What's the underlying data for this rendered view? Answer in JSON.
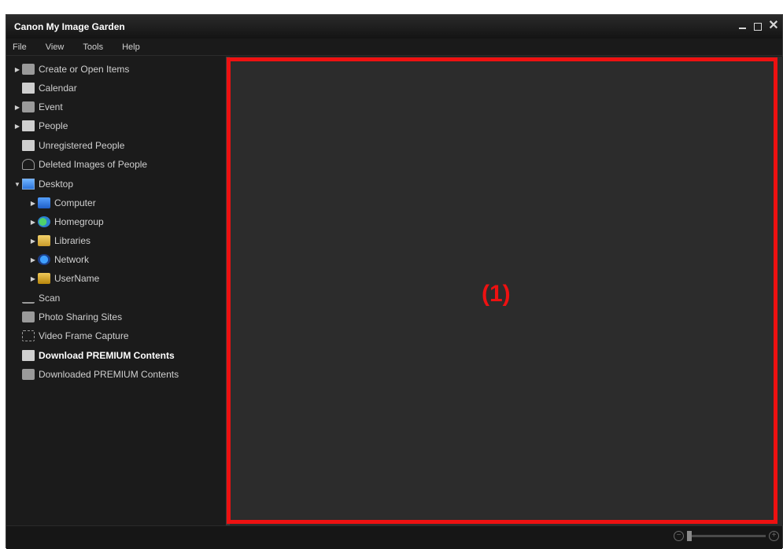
{
  "window": {
    "title": "Canon My Image Garden"
  },
  "menu": [
    "File",
    "View",
    "Tools",
    "Help"
  ],
  "tree": [
    {
      "label": "Create or Open Items",
      "icon": "create-items-icon",
      "expandable": true
    },
    {
      "label": "Calendar",
      "icon": "calendar-icon",
      "expandable": false
    },
    {
      "label": "Event",
      "icon": "event-icon",
      "expandable": true
    },
    {
      "label": "People",
      "icon": "people-icon",
      "expandable": true
    },
    {
      "label": "Unregistered People",
      "icon": "unregistered-people-icon",
      "expandable": false
    },
    {
      "label": "Deleted Images of People",
      "icon": "deleted-people-icon",
      "expandable": false
    },
    {
      "label": "Desktop",
      "icon": "desktop-icon",
      "expandable": true,
      "expanded": true
    },
    {
      "label": "Computer",
      "icon": "computer-icon",
      "expandable": true
    },
    {
      "label": "Homegroup",
      "icon": "homegroup-icon",
      "expandable": true
    },
    {
      "label": "Libraries",
      "icon": "libraries-icon",
      "expandable": true
    },
    {
      "label": "Network",
      "icon": "network-icon",
      "expandable": true
    },
    {
      "label": "UserName",
      "icon": "user-folder-icon",
      "expandable": true
    },
    {
      "label": "Scan",
      "icon": "scan-icon",
      "expandable": false
    },
    {
      "label": "Photo Sharing Sites",
      "icon": "photo-sharing-icon",
      "expandable": false
    },
    {
      "label": "Video Frame Capture",
      "icon": "video-capture-icon",
      "expandable": false
    },
    {
      "label": "Download PREMIUM Contents",
      "icon": "download-premium-icon",
      "expandable": false,
      "selected": true
    },
    {
      "label": "Downloaded PREMIUM Contents",
      "icon": "downloaded-premium-icon",
      "expandable": false
    }
  ],
  "annotation": {
    "label": "(1)",
    "color": "#ee1111"
  }
}
